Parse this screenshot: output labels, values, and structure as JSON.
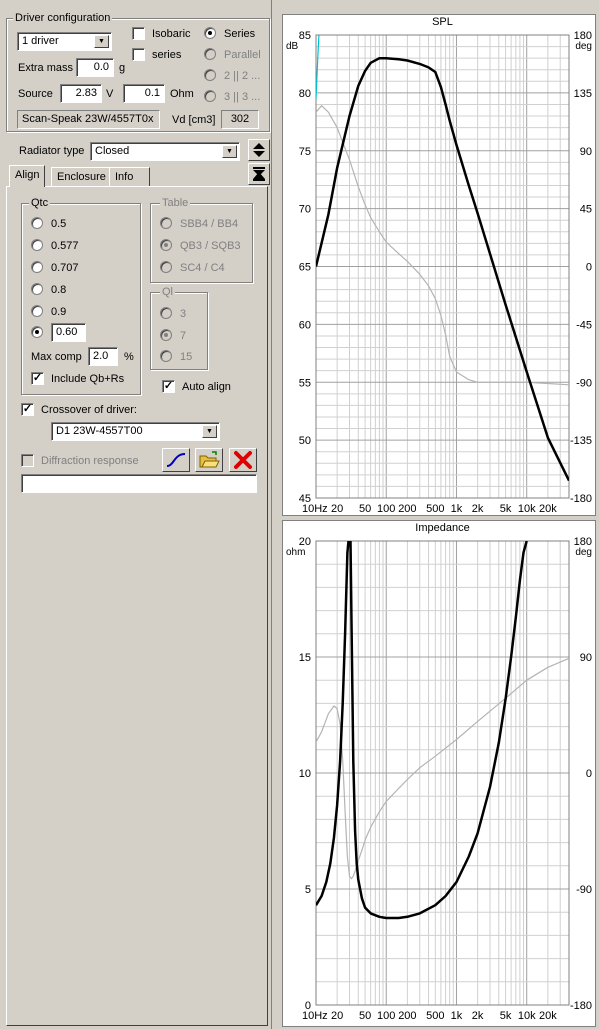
{
  "driver_config": {
    "title": "Driver configuration",
    "drivers_select": "1 driver",
    "isobaric_label": "Isobaric",
    "series_chk_label": "series",
    "wiring": [
      "Series",
      "Parallel",
      "2 || 2 ...",
      "3 || 3 ..."
    ],
    "extra_mass_label": "Extra mass",
    "extra_mass_value": "0.0",
    "extra_mass_unit": "g",
    "source_label": "Source",
    "source_voltage": "2.83",
    "source_voltage_unit": "V",
    "source_resistance": "0.1",
    "source_resistance_unit": "Ohm",
    "driver_name": "Scan-Speak 23W/4557T0x",
    "vd_label": "Vd [cm3]",
    "vd_value": "302"
  },
  "radiator": {
    "label": "Radiator type",
    "value": "Closed"
  },
  "tabs": [
    "Align",
    "Enclosure",
    "Info"
  ],
  "qtc": {
    "title": "Qtc",
    "options": [
      "0.5",
      "0.577",
      "0.707",
      "0.8",
      "0.9"
    ],
    "custom_value": "0.60",
    "max_comp_label": "Max comp",
    "max_comp_value": "2.0",
    "max_comp_unit": "%",
    "include_label": "Include Qb+Rs"
  },
  "table": {
    "title": "Table",
    "options": [
      "SBB4 / BB4",
      "QB3 / SQB3",
      "SC4 / C4"
    ]
  },
  "ql": {
    "title": "Ql",
    "options": [
      "3",
      "7",
      "15"
    ]
  },
  "auto_align_label": "Auto align",
  "crossover": {
    "label": "Crossover of driver:",
    "value": "D1 23W-4557T00"
  },
  "diffraction_label": "Diffraction response",
  "diffraction_value": "",
  "colors": {
    "bg": "#d4d0c8",
    "curve_main": "#000000",
    "curve_phase": "#b4b4b4",
    "curve_cyan": "#00c0d0",
    "grid": "#d0d0d0"
  },
  "icons": [
    "up-down-arrow-icon",
    "collapse-icon",
    "curve-icon",
    "open-folder-icon",
    "delete-icon"
  ],
  "chart_data": [
    {
      "type": "line",
      "title": "SPL",
      "y_unit_left": "dB",
      "y_unit_right": "deg",
      "xlim": [
        10,
        40000
      ],
      "x_scale": "log",
      "ylim_left": [
        45,
        85
      ],
      "ylim_right": [
        -180,
        180
      ],
      "x_ticks": [
        "10Hz",
        "20",
        "50",
        "100",
        "200",
        "500",
        "1k",
        "2k",
        "5k",
        "10k",
        "20k"
      ],
      "x_tick_values": [
        10,
        20,
        50,
        100,
        200,
        500,
        1000,
        2000,
        5000,
        10000,
        20000
      ],
      "y_ticks_left": [
        "85",
        "80",
        "75",
        "70",
        "65",
        "60",
        "55",
        "50",
        "45"
      ],
      "y_ticks_right": [
        "180",
        "135",
        "90",
        "45",
        "0",
        "-45",
        "-90",
        "-135",
        "-180"
      ],
      "series": [
        {
          "axis": "left",
          "x": [
            10,
            15,
            20,
            30,
            40,
            50,
            60,
            80,
            100,
            150,
            200,
            300,
            400,
            500,
            600,
            700,
            800,
            1000,
            1500,
            2000,
            3000,
            5000,
            10000,
            20000,
            40000
          ],
          "y": [
            65,
            69.5,
            73.5,
            78,
            80.6,
            81.9,
            82.6,
            83.0,
            83.0,
            82.9,
            82.8,
            82.5,
            82.2,
            81.8,
            80.5,
            79.0,
            77.6,
            75.5,
            72.0,
            69.6,
            66.1,
            61.7,
            55.9,
            50.2,
            46.5
          ]
        },
        {
          "axis": "right",
          "x": [
            10,
            12,
            15,
            20,
            30,
            40,
            50,
            60,
            80,
            100,
            150,
            200,
            300,
            400,
            500,
            600,
            700,
            800,
            1000,
            1500,
            2000,
            5000,
            10000,
            20000,
            40000
          ],
          "y": [
            120,
            125,
            120,
            108,
            83,
            62,
            48,
            38,
            27,
            19,
            10,
            4,
            -6,
            -15,
            -25,
            -38,
            -53,
            -70,
            -82,
            -88,
            -90,
            -90,
            -90,
            -91,
            -92
          ]
        },
        {
          "axis": "left",
          "x": [
            10,
            10.5,
            11
          ],
          "y": [
            79.5,
            82.5,
            85
          ]
        }
      ]
    },
    {
      "type": "line",
      "title": "Impedance",
      "y_unit_left": "ohm",
      "y_unit_right": "deg",
      "xlim": [
        10,
        40000
      ],
      "x_scale": "log",
      "ylim_left": [
        0,
        20
      ],
      "ylim_right": [
        -180,
        180
      ],
      "x_ticks": [
        "10Hz",
        "20",
        "50",
        "100",
        "200",
        "500",
        "1k",
        "2k",
        "5k",
        "10k",
        "20k"
      ],
      "x_tick_values": [
        10,
        20,
        50,
        100,
        200,
        500,
        1000,
        2000,
        5000,
        10000,
        20000
      ],
      "y_ticks_left": [
        "20",
        "15",
        "10",
        "5",
        "0"
      ],
      "y_ticks_right": [
        "180",
        "90",
        "0",
        "-90",
        "-180"
      ],
      "series": [
        {
          "axis": "left",
          "x": [
            10,
            12,
            14,
            16,
            18,
            20,
            22,
            24,
            26,
            28,
            29,
            30,
            31,
            32,
            34,
            36,
            38,
            40,
            45,
            50,
            60,
            80,
            100,
            150,
            200,
            300,
            500,
            700,
            1000,
            1500,
            2000,
            3000,
            4000,
            5000,
            6000,
            7000,
            8000,
            9000,
            10000
          ],
          "y": [
            4.3,
            4.7,
            5.3,
            6.1,
            7.2,
            8.6,
            10.5,
            13.0,
            16.0,
            19.5,
            20.0,
            20.0,
            20.0,
            16.5,
            10.5,
            7.5,
            6.1,
            5.4,
            4.6,
            4.2,
            3.95,
            3.8,
            3.75,
            3.75,
            3.8,
            3.95,
            4.3,
            4.7,
            5.3,
            6.4,
            7.4,
            9.4,
            11.3,
            13.2,
            15.0,
            16.7,
            18.3,
            19.5,
            20.0
          ]
        },
        {
          "axis": "right",
          "x": [
            10,
            12,
            15,
            18,
            20,
            22,
            24,
            26,
            28,
            30,
            32,
            34,
            36,
            40,
            45,
            50,
            60,
            80,
            100,
            150,
            200,
            300,
            500,
            1000,
            2000,
            5000,
            10000,
            20000,
            40000
          ],
          "y": [
            24,
            32,
            46,
            52,
            50,
            38,
            10,
            -30,
            -65,
            -80,
            -82,
            -80,
            -76,
            -68,
            -60,
            -52,
            -42,
            -30,
            -22,
            -12,
            -5,
            4,
            13,
            26,
            40,
            58,
            72,
            82,
            89
          ]
        }
      ]
    }
  ]
}
